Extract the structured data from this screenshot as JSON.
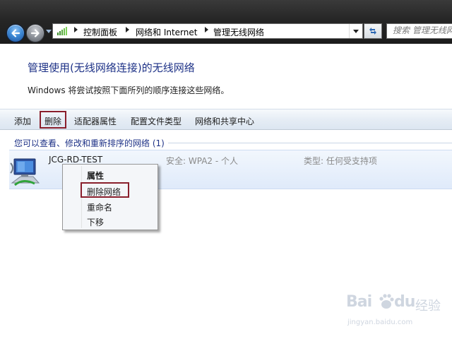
{
  "breadcrumb": [
    "控制面板",
    "网络和 Internet",
    "管理无线网络"
  ],
  "search": {
    "placeholder": "搜索 管理无线网络"
  },
  "main": {
    "heading": "管理使用(无线网络连接)的无线网络",
    "description": "Windows 将尝试按照下面所列的顺序连接这些网络。"
  },
  "toolbar": {
    "add": "添加",
    "remove": "删除",
    "adapter_properties": "适配器属性",
    "profile_types": "配置文件类型",
    "network_sharing_center": "网络和共享中心"
  },
  "network_group": {
    "header": "您可以查看、修改和重新排序的网络 (1)"
  },
  "networks": [
    {
      "name": "JCG-RD-TEST",
      "security": "安全: WPA2 - 个人",
      "type": "类型: 任何受支持项"
    }
  ],
  "context_menu": {
    "items": [
      "属性",
      "删除网络",
      "重命名",
      "下移"
    ],
    "default_item": "属性",
    "highlighted_item": "删除网络"
  },
  "watermark": {
    "brand": "Bai",
    "brand2": "经验",
    "url": "jingyan.baidu.com"
  },
  "colors": {
    "heading": "#1e3287",
    "highlight_box": "#8a1f2c",
    "title_bar": "#262626",
    "row_background": "#e6eefa"
  },
  "icons": {
    "back": "back-arrow-icon",
    "forward": "forward-arrow-icon",
    "address": "network-folder-icon",
    "refresh": "refresh-icon",
    "network": "wireless-network-icon"
  }
}
